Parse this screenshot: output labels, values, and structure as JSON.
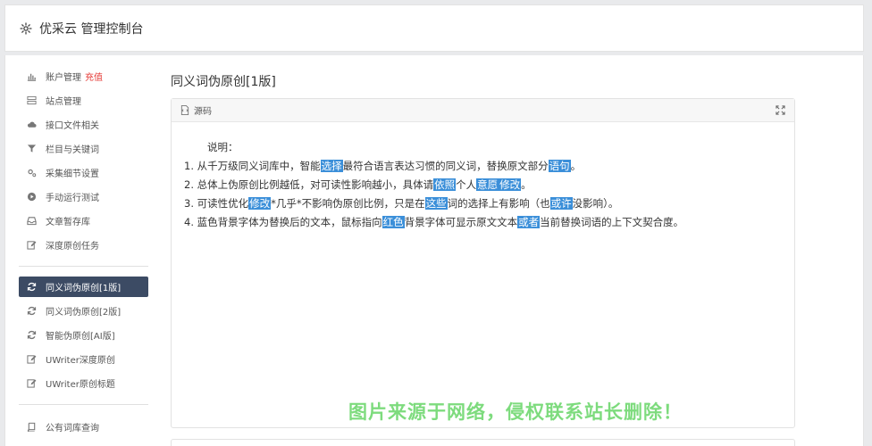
{
  "header": {
    "title": "优采云 管理控制台"
  },
  "sidebar": {
    "group1": [
      {
        "icon": "bar-chart-icon",
        "label": "账户管理",
        "badge": "充值"
      },
      {
        "icon": "server-icon",
        "label": "站点管理"
      },
      {
        "icon": "cloud-icon",
        "label": "接口文件相关"
      },
      {
        "icon": "filter-icon",
        "label": "栏目与关键词"
      },
      {
        "icon": "cogs-icon",
        "label": "采集细节设置"
      },
      {
        "icon": "play-circle-icon",
        "label": "手动运行测试"
      },
      {
        "icon": "inbox-icon",
        "label": "文章暂存库"
      },
      {
        "icon": "edit-icon",
        "label": "深度原创任务"
      }
    ],
    "group2": [
      {
        "icon": "refresh-icon",
        "label": "同义词伪原创[1版]",
        "active": true
      },
      {
        "icon": "refresh-icon",
        "label": "同义词伪原创[2版]"
      },
      {
        "icon": "refresh-icon",
        "label": "智能伪原创[AI版]"
      },
      {
        "icon": "edit-icon",
        "label": "UWriter深度原创"
      },
      {
        "icon": "edit-icon",
        "label": "UWriter原创标题"
      }
    ],
    "group3": [
      {
        "icon": "book-icon",
        "label": "公有词库查询"
      }
    ]
  },
  "main": {
    "title": "同义词伪原创[1版]",
    "card": {
      "head_label": "源码",
      "intro": "说明：",
      "lines": [
        [
          {
            "t": "1. 从千万级同义词库中，智能"
          },
          {
            "t": "选择",
            "hl": true
          },
          {
            "t": "最符合语言表达习惯的同义词，替换原文部分"
          },
          {
            "t": "语句",
            "hl": true
          },
          {
            "t": "。"
          }
        ],
        [
          {
            "t": "2. 总体上伪原创比例越低，对可读性影响越小，具体请"
          },
          {
            "t": "依照",
            "hl": true
          },
          {
            "t": "个人"
          },
          {
            "t": "意愿",
            "hl": true
          },
          {
            "t": "修改",
            "hl": true
          },
          {
            "t": "。"
          }
        ],
        [
          {
            "t": "3. 可读性优化"
          },
          {
            "t": "修改",
            "hl": true
          },
          {
            "t": "*几乎*不影响伪原创比例，只是在"
          },
          {
            "t": "这些",
            "hl": true
          },
          {
            "t": "词的选择上有影响（也"
          },
          {
            "t": "或许",
            "hl": true
          },
          {
            "t": "没影响）。"
          }
        ],
        [
          {
            "t": "4. 蓝色背景字体为替换后的文本，鼠标指向"
          },
          {
            "t": "红色",
            "hl": true
          },
          {
            "t": "背景字体可显示原文文本"
          },
          {
            "t": "或者",
            "hl": true
          },
          {
            "t": "当前替换词语的上下文契合度。"
          }
        ]
      ]
    }
  },
  "watermark": "图片来源于网络，侵权联系站长删除！",
  "colors": {
    "accent": "#3b8fd9",
    "active_nav": "#3c4b64",
    "badge": "#e53935",
    "watermark": "#6fd86f"
  }
}
